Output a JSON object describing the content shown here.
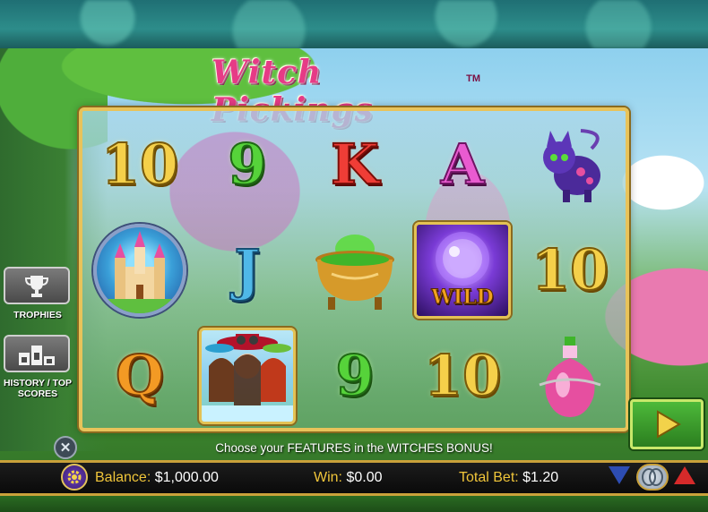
{
  "game": {
    "title": "Witch Pickings",
    "trademark": "TM"
  },
  "reels": [
    [
      {
        "type": "number",
        "text": "10",
        "color": "gold"
      },
      {
        "type": "castle",
        "icon": "castle-icon"
      },
      {
        "type": "number",
        "text": "Q",
        "color": "orange"
      }
    ],
    [
      {
        "type": "number",
        "text": "9",
        "color": "green"
      },
      {
        "type": "number",
        "text": "J",
        "color": "blue"
      },
      {
        "type": "witches",
        "icon": "witches-icon"
      }
    ],
    [
      {
        "type": "number",
        "text": "K",
        "color": "red"
      },
      {
        "type": "cauldron",
        "icon": "cauldron-icon"
      },
      {
        "type": "number",
        "text": "9",
        "color": "green"
      }
    ],
    [
      {
        "type": "number",
        "text": "A",
        "color": "pink"
      },
      {
        "type": "wild",
        "text": "WILD",
        "icon": "crystal-ball-icon"
      },
      {
        "type": "number",
        "text": "10",
        "color": "gold"
      }
    ],
    [
      {
        "type": "cat",
        "icon": "cat-icon"
      },
      {
        "type": "number",
        "text": "10",
        "color": "gold"
      },
      {
        "type": "potion",
        "icon": "potion-icon"
      }
    ]
  ],
  "side_menu": {
    "trophies_label": "TROPHIES",
    "history_label": "HISTORY / TOP SCORES"
  },
  "message": "Choose your FEATURES in the WITCHES BONUS!",
  "status": {
    "balance_label": "Balance:",
    "balance_value": "$1,000.00",
    "win_label": "Win:",
    "win_value": "$0.00",
    "total_bet_label": "Total Bet:",
    "total_bet_value": "$1.20"
  },
  "colors": {
    "frame_gold": "#e8c35a",
    "label_yellow": "#f0c53a",
    "spin_green": "#3ea12f",
    "bet_up_red": "#d62a2a",
    "bet_down_blue": "#2d4db3"
  }
}
